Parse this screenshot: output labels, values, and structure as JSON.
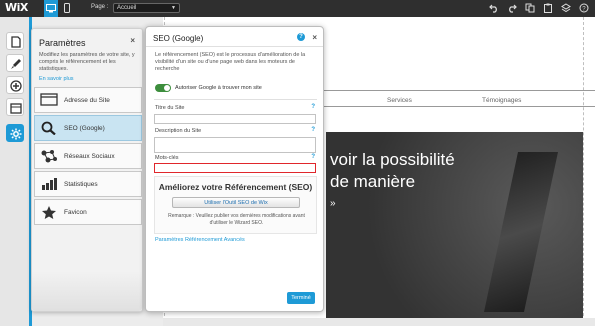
{
  "topbar": {
    "logo": "WiX",
    "page_label": "Page :",
    "page_select_value": "Accueil",
    "icons": [
      "undo-icon",
      "redo-icon",
      "copy-icon",
      "paste-icon",
      "layers-icon",
      "help-icon"
    ]
  },
  "site": {
    "nav": [
      "Services",
      "Témoignages"
    ],
    "hero_lines": [
      "voir la possibilité",
      "de manière",
      "»"
    ]
  },
  "settings_panel": {
    "title": "Paramètres",
    "close": "×",
    "description": "Modifiez les paramètres de votre site, y compris le référencement et les statistiques.",
    "learn_more": "En savoir plus",
    "items": [
      {
        "label": "Adresse du Site",
        "icon": "browser-window-icon"
      },
      {
        "label": "SEO (Google)",
        "icon": "magnifier-icon"
      },
      {
        "label": "Réseaux Sociaux",
        "icon": "social-network-icon"
      },
      {
        "label": "Statistiques",
        "icon": "bar-chart-icon"
      },
      {
        "label": "Favicon",
        "icon": "star-icon"
      }
    ],
    "selected_index": 1
  },
  "seo_dialog": {
    "title": "SEO (Google)",
    "help": "?",
    "close": "×",
    "description": "Le référencement (SEO) est le processus d'amélioration de la visibilité d'un site ou d'une page web dans les moteurs de recherche",
    "toggle_label": "Autoriser Google à trouver mon site",
    "toggle_on": true,
    "fields": {
      "site_title": {
        "label": "Titre du Site",
        "value": "",
        "help": "?"
      },
      "site_description": {
        "label": "Description du Site",
        "value": "",
        "help": "?"
      },
      "keywords": {
        "label": "Mots-clés",
        "value": "",
        "help": "?"
      }
    },
    "promo": {
      "title": "Améliorez votre Référencement (SEO)",
      "button": "Utiliser l'Outil SEO de Wix",
      "note": "Remarque : Veuillez publier vos dernières modifications avant d'utiliser le Wizard SEO."
    },
    "advanced_link": "Paramètres Référencement Avancés",
    "done_button": "Terminé"
  },
  "colors": {
    "accent": "#1e9ad6",
    "topbar": "#2f2f2f",
    "highlight": "#e0262b",
    "toggle_on": "#3d8e3d"
  }
}
